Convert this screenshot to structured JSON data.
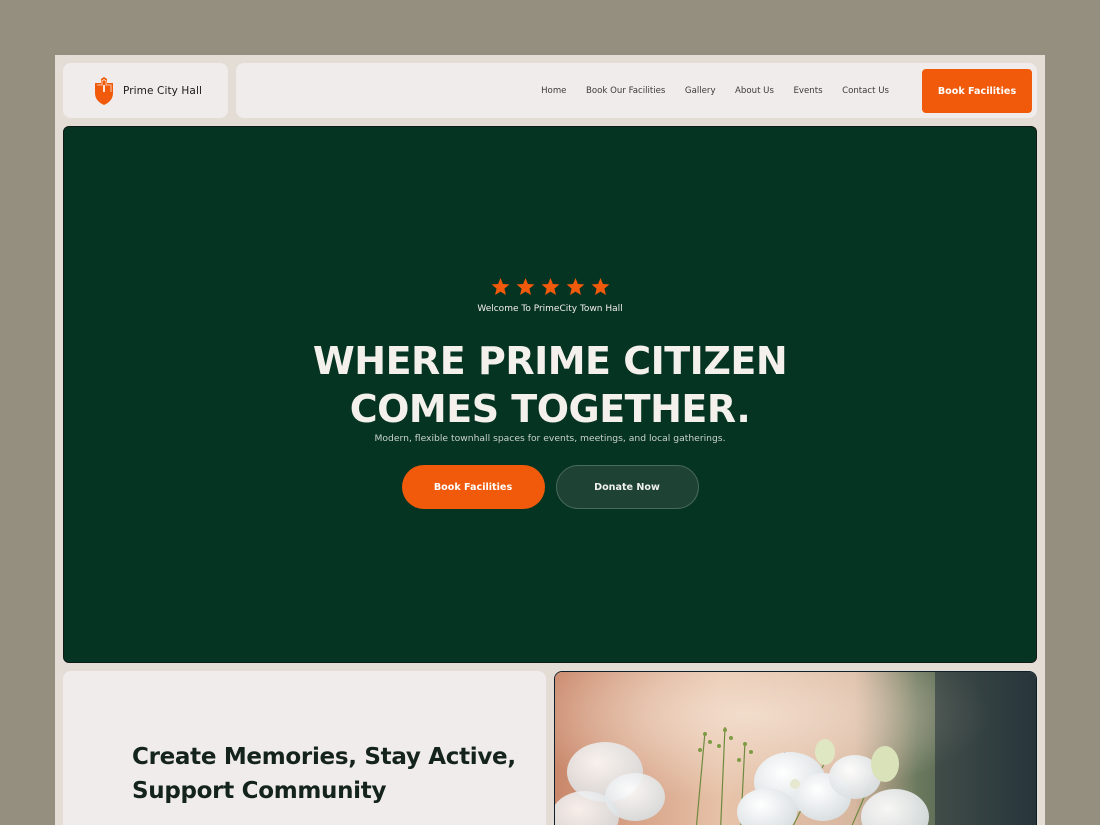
{
  "brand": {
    "name": "Prime City Hall",
    "accent_color": "#f05a0a",
    "logo_icon": "town-hall-icon"
  },
  "nav": {
    "links": [
      "Home",
      "Book Our Facilities",
      "Gallery",
      "About Us",
      "Events",
      "Contact Us"
    ],
    "cta_label": "Book Facilities"
  },
  "hero": {
    "rating": 5,
    "welcome": "Welcome To PrimeCity Town Hall",
    "headline_line1": "WHERE PRIME CITIZEN",
    "headline_line2": "COMES TOGETHER.",
    "subtitle": "Modern, flexible townhall spaces for events, meetings, and local gatherings.",
    "primary_button": "Book Facilities",
    "secondary_button": "Donate Now",
    "background_color": "#063423"
  },
  "about": {
    "title_line1": "Create Memories, Stay Active,",
    "title_line2": "Support Community"
  },
  "photo": {
    "icon": "flowers-photo"
  }
}
